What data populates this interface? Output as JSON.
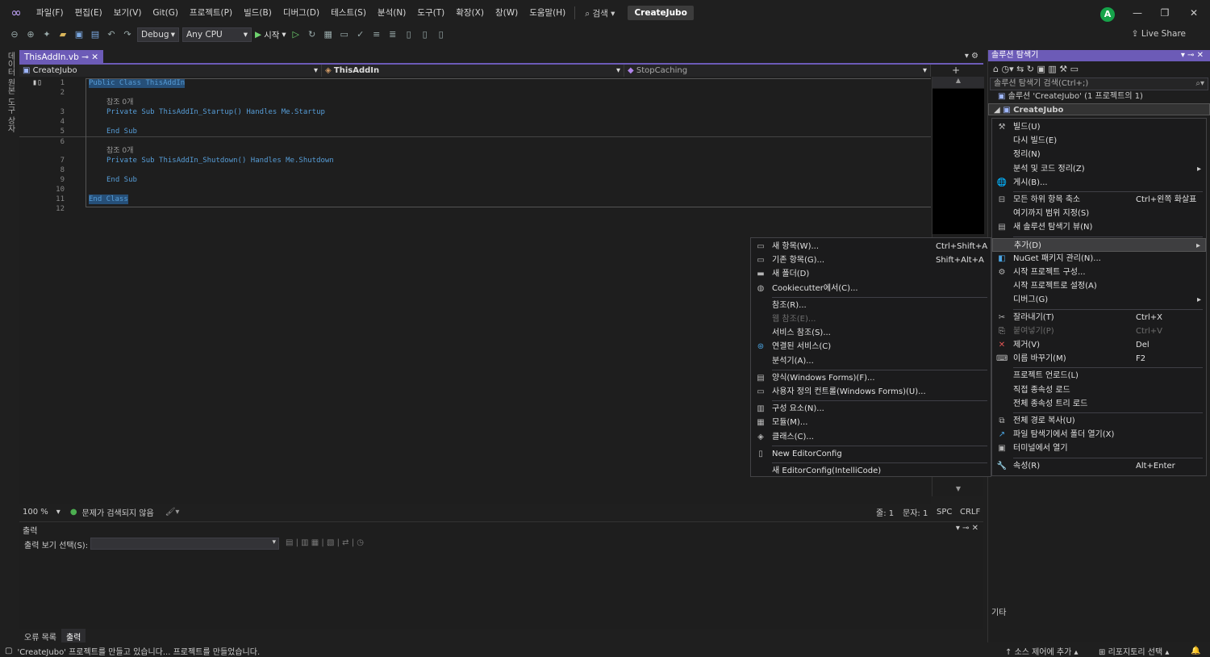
{
  "menubar": {
    "items": [
      "파일(F)",
      "편집(E)",
      "보기(V)",
      "Git(G)",
      "프로젝트(P)",
      "빌드(B)",
      "디버그(D)",
      "테스트(S)",
      "분석(N)",
      "도구(T)",
      "확장(X)",
      "창(W)",
      "도움말(H)"
    ],
    "search": "검색",
    "project_badge": "CreateJubo",
    "avatar": "A"
  },
  "toolbar": {
    "config": "Debug",
    "platform": "Any CPU",
    "start": "시작",
    "live_share": "Live Share"
  },
  "left_tabs": [
    "데이터 원본",
    "도구 상자"
  ],
  "doc_tab": "ThisAddIn.vb",
  "navbar": {
    "project": "CreateJubo",
    "class": "ThisAddIn",
    "member": "StopCaching"
  },
  "code": {
    "lines": [
      {
        "n": "1",
        "text": "Public Class ThisAddIn"
      },
      {
        "n": "2",
        "text": ""
      },
      {
        "n": "",
        "text": "참조 0개"
      },
      {
        "n": "3",
        "text": "Private Sub ThisAddIn_Startup() Handles Me.Startup"
      },
      {
        "n": "4",
        "text": ""
      },
      {
        "n": "5",
        "text": "End Sub"
      },
      {
        "n": "6",
        "text": ""
      },
      {
        "n": "",
        "text": "참조 0개"
      },
      {
        "n": "7",
        "text": "Private Sub ThisAddIn_Shutdown() Handles Me.Shutdown"
      },
      {
        "n": "8",
        "text": ""
      },
      {
        "n": "9",
        "text": "End Sub"
      },
      {
        "n": "10",
        "text": ""
      },
      {
        "n": "11",
        "text": "End Class"
      },
      {
        "n": "12",
        "text": ""
      }
    ]
  },
  "editor_status": {
    "zoom": "100 %",
    "issues": "문제가 검색되지 않음",
    "line": "줄: 1",
    "col": "문자: 1",
    "spc": "SPC",
    "eol": "CRLF"
  },
  "output": {
    "title": "출력",
    "show_from_label": "출력 보기 선택(S):",
    "tabs": [
      "오류 목록",
      "출력"
    ]
  },
  "solution_explorer": {
    "title": "솔루션 탐색기",
    "search_placeholder": "솔루션 탐색기 검색(Ctrl+;)",
    "solution_node": "솔루션 'CreateJubo' (1 프로젝트의 1)",
    "project_node": "CreateJubo",
    "other": "기타"
  },
  "context_menu_main": [
    {
      "icon": "build",
      "label": "빌드(U)",
      "shortcut": ""
    },
    {
      "icon": "",
      "label": "다시 빌드(E)",
      "shortcut": ""
    },
    {
      "icon": "",
      "label": "정리(N)",
      "shortcut": ""
    },
    {
      "icon": "",
      "label": "분석 및 코드 정리(Z)",
      "shortcut": "",
      "submenu": true
    },
    {
      "icon": "globe",
      "label": "게시(B)...",
      "shortcut": ""
    },
    {
      "sep": true
    },
    {
      "icon": "collapse",
      "label": "모든 하위 항목 축소",
      "shortcut": "Ctrl+왼쪽 화살표"
    },
    {
      "icon": "",
      "label": "여기까지 범위 지정(S)",
      "shortcut": ""
    },
    {
      "icon": "newview",
      "label": "새 솔루션 탐색기 뷰(N)",
      "shortcut": ""
    },
    {
      "sep": true
    },
    {
      "icon": "",
      "label": "추가(D)",
      "shortcut": "",
      "submenu": true,
      "highlight": true
    },
    {
      "icon": "nuget",
      "label": "NuGet 패키지 관리(N)...",
      "shortcut": ""
    },
    {
      "icon": "gear",
      "label": "시작 프로젝트 구성...",
      "shortcut": ""
    },
    {
      "icon": "",
      "label": "시작 프로젝트로 설정(A)",
      "shortcut": ""
    },
    {
      "icon": "",
      "label": "디버그(G)",
      "shortcut": "",
      "submenu": true
    },
    {
      "sep": true
    },
    {
      "icon": "cut",
      "label": "잘라내기(T)",
      "shortcut": "Ctrl+X"
    },
    {
      "icon": "paste",
      "label": "붙여넣기(P)",
      "shortcut": "Ctrl+V",
      "disabled": true
    },
    {
      "icon": "delete",
      "label": "제거(V)",
      "shortcut": "Del"
    },
    {
      "icon": "rename",
      "label": "이름 바꾸기(M)",
      "shortcut": "F2"
    },
    {
      "sep": true
    },
    {
      "icon": "",
      "label": "프로젝트 언로드(L)",
      "shortcut": ""
    },
    {
      "icon": "",
      "label": "직접 종속성 로드",
      "shortcut": ""
    },
    {
      "icon": "",
      "label": "전체 종속성 트리 로드",
      "shortcut": ""
    },
    {
      "sep": true
    },
    {
      "icon": "copy",
      "label": "전체 경로 복사(U)",
      "shortcut": ""
    },
    {
      "icon": "folder-arrow",
      "label": "파일 탐색기에서 폴더 열기(X)",
      "shortcut": ""
    },
    {
      "icon": "terminal",
      "label": "터미널에서 열기",
      "shortcut": ""
    },
    {
      "sep": true
    },
    {
      "icon": "wrench",
      "label": "속성(R)",
      "shortcut": "Alt+Enter"
    }
  ],
  "context_menu_add": [
    {
      "icon": "newitem",
      "label": "새 항목(W)...",
      "shortcut": "Ctrl+Shift+A"
    },
    {
      "icon": "existitem",
      "label": "기존 항목(G)...",
      "shortcut": "Shift+Alt+A"
    },
    {
      "icon": "newfolder",
      "label": "새 폴더(D)",
      "shortcut": ""
    },
    {
      "icon": "cookie",
      "label": "Cookiecutter에서(C)...",
      "shortcut": ""
    },
    {
      "sep": true
    },
    {
      "icon": "",
      "label": "참조(R)...",
      "shortcut": ""
    },
    {
      "icon": "",
      "label": "웹 참조(E)...",
      "shortcut": "",
      "disabled": true
    },
    {
      "icon": "",
      "label": "서비스 참조(S)...",
      "shortcut": ""
    },
    {
      "icon": "connected",
      "label": "연결된 서비스(C)",
      "shortcut": ""
    },
    {
      "icon": "",
      "label": "분석기(A)...",
      "shortcut": ""
    },
    {
      "sep": true
    },
    {
      "icon": "form",
      "label": "양식(Windows Forms)(F)...",
      "shortcut": ""
    },
    {
      "icon": "userctrl",
      "label": "사용자 정의 컨트롤(Windows Forms)(U)...",
      "shortcut": ""
    },
    {
      "sep": true
    },
    {
      "icon": "component",
      "label": "구성 요소(N)...",
      "shortcut": ""
    },
    {
      "icon": "module",
      "label": "모듈(M)...",
      "shortcut": ""
    },
    {
      "icon": "class",
      "label": "클래스(C)...",
      "shortcut": ""
    },
    {
      "sep": true
    },
    {
      "icon": "editorconfig",
      "label": "New EditorConfig",
      "shortcut": ""
    },
    {
      "sep": true
    },
    {
      "icon": "",
      "label": "새 EditorConfig(IntelliCode)",
      "shortcut": ""
    }
  ],
  "statusbar": {
    "message": "'CreateJubo' 프로젝트를 만들고 있습니다... 프로젝트를 만들었습니다.",
    "source_control": "소스 제어에 추가",
    "repo": "리포지토리 선택"
  },
  "colors": {
    "accent": "#6c5bb7",
    "menu_bg": "#1b1b1c",
    "editor_bg": "#1e1e1e",
    "keyword": "#569cd6"
  }
}
